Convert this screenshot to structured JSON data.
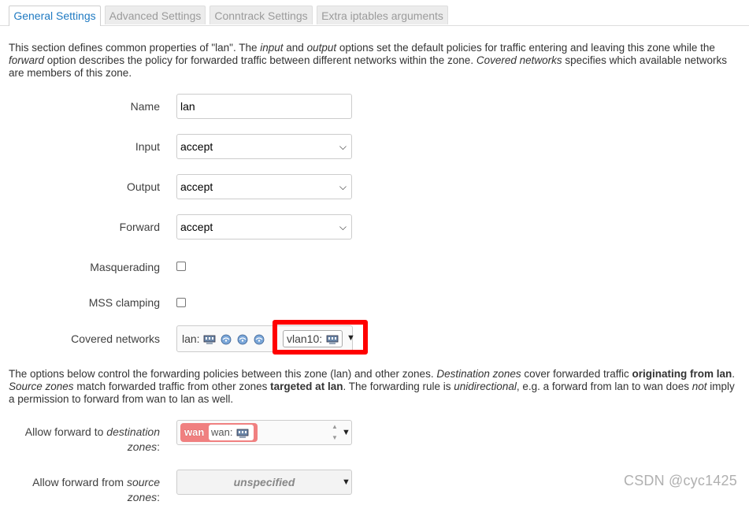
{
  "tabs": [
    {
      "label": "General Settings",
      "active": true
    },
    {
      "label": "Advanced Settings",
      "active": false
    },
    {
      "label": "Conntrack Settings",
      "active": false
    },
    {
      "label": "Extra iptables arguments",
      "active": false
    }
  ],
  "intro": {
    "p1_a": "This section defines common properties of \"lan\". The ",
    "p1_input": "input",
    "p1_b": " and ",
    "p1_output": "output",
    "p1_c": " options set the default policies for traffic entering and leaving this zone while the ",
    "p1_forward": "forward",
    "p1_d": " option describes the policy for forwarded traffic between different networks within the zone. ",
    "p1_covered": "Covered networks",
    "p1_e": " specifies which available networks are members of this zone."
  },
  "fields": {
    "name_label": "Name",
    "name_value": "lan",
    "input_label": "Input",
    "input_value": "accept",
    "output_label": "Output",
    "output_value": "accept",
    "forward_label": "Forward",
    "forward_value": "accept",
    "masq_label": "Masquerading",
    "masq_checked": false,
    "mss_label": "MSS clamping",
    "mss_checked": false,
    "covered_label": "Covered networks",
    "covered_lan": "lan:",
    "covered_vlan": "vlan10:"
  },
  "forwarding": {
    "p_a": "The options below control the forwarding policies between this zone (lan) and other zones. ",
    "p_dest": "Destination zones",
    "p_b": " cover forwarded traffic ",
    "p_orig": "originating from lan",
    "p_c": ". ",
    "p_src": "Source zones",
    "p_d": " match forwarded traffic from other zones ",
    "p_target": "targeted at lan",
    "p_e": ". The forwarding rule is ",
    "p_uni": "unidirectional",
    "p_f": ", e.g. a forward from lan to wan does ",
    "p_not": "not",
    "p_g": " imply a permission to forward from wan to lan as well.",
    "dest_label_a": "Allow forward to ",
    "dest_label_b": "destination",
    "dest_label_c": "zones",
    "dest_label_d": ":",
    "dest_zone": "wan",
    "dest_zone_net": "wan:",
    "src_label_a": "Allow forward from ",
    "src_label_b": "source",
    "src_label_c": "zones",
    "src_label_d": ":",
    "src_value": "unspecified"
  },
  "watermark": "CSDN @cyc1425",
  "colors": {
    "accent": "#1f7ac2",
    "zone_wan": "#f08080",
    "highlight": "#ff0000"
  }
}
